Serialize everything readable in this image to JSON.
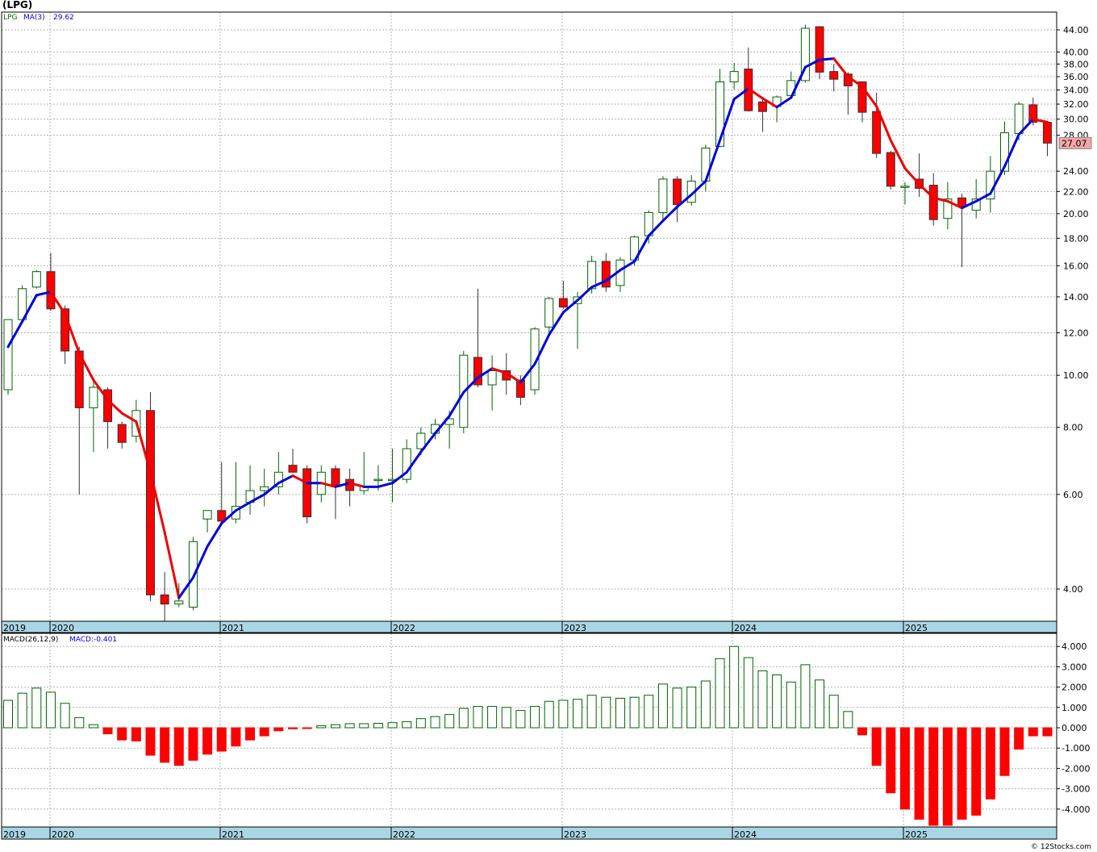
{
  "title": "(LPG)",
  "legend": {
    "symbol": "LPG",
    "ma_label": "MA(3)",
    "ma_value": "29.62"
  },
  "macd_legend": {
    "label": "MACD(26,12,9)",
    "value_label": "MACD:-0.401"
  },
  "last_price_label": "27.07",
  "copyright": "© 12Stocks.com",
  "colors": {
    "up": "#006400",
    "down": "#ff0000",
    "ma_up": "#0000dd",
    "ma_down": "#ee0000",
    "axis_band": "#a9d6e5",
    "grid": "#b0b0b0",
    "price_box": "#f4a6a6"
  },
  "chart_data": {
    "type": "candlestick",
    "scale": "log",
    "price_ticks": [
      "4.00",
      "6.00",
      "8.00",
      "10.00",
      "12.00",
      "14.00",
      "16.00",
      "18.00",
      "20.00",
      "22.00",
      "24.00",
      "28.00",
      "30.00",
      "32.00",
      "34.00",
      "36.00",
      "38.00",
      "40.00",
      "44.00"
    ],
    "year_labels": [
      "2019",
      "2020",
      "2021",
      "2022",
      "2023",
      "2024",
      "2025"
    ],
    "macd_ticks": [
      "4.000",
      "3.000",
      "2.000",
      "1.000",
      "0.000",
      "-1.000",
      "-2.000",
      "-3.000",
      "-4.000"
    ],
    "candles": [
      {
        "o": 9.4,
        "h": 12.7,
        "l": 9.2,
        "c": 12.7
      },
      {
        "o": 12.7,
        "h": 14.7,
        "l": 12.5,
        "c": 14.5
      },
      {
        "o": 14.6,
        "h": 15.7,
        "l": 14.5,
        "c": 15.6
      },
      {
        "o": 15.6,
        "h": 16.9,
        "l": 13.2,
        "c": 13.3
      },
      {
        "o": 13.3,
        "h": 13.5,
        "l": 10.5,
        "c": 11.1
      },
      {
        "o": 11.1,
        "h": 11.3,
        "l": 6.0,
        "c": 8.7
      },
      {
        "o": 8.7,
        "h": 9.9,
        "l": 7.2,
        "c": 9.5
      },
      {
        "o": 9.4,
        "h": 9.5,
        "l": 7.3,
        "c": 8.2
      },
      {
        "o": 8.1,
        "h": 8.2,
        "l": 7.3,
        "c": 7.5
      },
      {
        "o": 7.7,
        "h": 9.0,
        "l": 7.5,
        "c": 8.6
      },
      {
        "o": 8.6,
        "h": 9.3,
        "l": 3.8,
        "c": 3.9
      },
      {
        "o": 3.9,
        "h": 4.3,
        "l": 3.45,
        "c": 3.75
      },
      {
        "o": 3.75,
        "h": 4.1,
        "l": 3.7,
        "c": 3.8
      },
      {
        "o": 3.7,
        "h": 5.0,
        "l": 3.65,
        "c": 4.9
      },
      {
        "o": 5.4,
        "h": 5.6,
        "l": 5.1,
        "c": 5.6
      },
      {
        "o": 5.6,
        "h": 6.9,
        "l": 5.3,
        "c": 5.35
      },
      {
        "o": 5.4,
        "h": 6.9,
        "l": 5.3,
        "c": 5.7
      },
      {
        "o": 5.8,
        "h": 6.8,
        "l": 5.5,
        "c": 6.1
      },
      {
        "o": 6.1,
        "h": 6.7,
        "l": 5.7,
        "c": 6.2
      },
      {
        "o": 6.2,
        "h": 7.2,
        "l": 6.0,
        "c": 6.6
      },
      {
        "o": 6.8,
        "h": 7.3,
        "l": 6.6,
        "c": 6.6
      },
      {
        "o": 6.7,
        "h": 6.8,
        "l": 5.3,
        "c": 5.45
      },
      {
        "o": 6.0,
        "h": 6.8,
        "l": 5.8,
        "c": 6.6
      },
      {
        "o": 6.7,
        "h": 6.8,
        "l": 5.4,
        "c": 6.2
      },
      {
        "o": 6.4,
        "h": 6.7,
        "l": 5.7,
        "c": 6.1
      },
      {
        "o": 6.1,
        "h": 7.2,
        "l": 6.0,
        "c": 6.2
      },
      {
        "o": 6.4,
        "h": 6.8,
        "l": 6.1,
        "c": 6.4
      },
      {
        "o": 6.4,
        "h": 7.3,
        "l": 5.8,
        "c": 6.4
      },
      {
        "o": 6.4,
        "h": 7.6,
        "l": 6.3,
        "c": 7.3
      },
      {
        "o": 7.3,
        "h": 8.0,
        "l": 7.1,
        "c": 7.8
      },
      {
        "o": 7.8,
        "h": 8.3,
        "l": 7.6,
        "c": 8.1
      },
      {
        "o": 8.1,
        "h": 8.6,
        "l": 7.3,
        "c": 8.3
      },
      {
        "o": 8.0,
        "h": 11.1,
        "l": 7.8,
        "c": 10.9
      },
      {
        "o": 10.8,
        "h": 14.5,
        "l": 9.5,
        "c": 9.6
      },
      {
        "o": 9.6,
        "h": 10.9,
        "l": 8.6,
        "c": 10.2
      },
      {
        "o": 10.2,
        "h": 11.0,
        "l": 9.2,
        "c": 9.8
      },
      {
        "o": 9.8,
        "h": 10.0,
        "l": 8.8,
        "c": 9.1
      },
      {
        "o": 9.4,
        "h": 12.3,
        "l": 9.2,
        "c": 12.2
      },
      {
        "o": 12.3,
        "h": 14.0,
        "l": 12.0,
        "c": 13.9
      },
      {
        "o": 13.9,
        "h": 15.0,
        "l": 13.3,
        "c": 13.4
      },
      {
        "o": 13.6,
        "h": 14.3,
        "l": 11.2,
        "c": 14.0
      },
      {
        "o": 14.5,
        "h": 16.7,
        "l": 14.2,
        "c": 16.3
      },
      {
        "o": 16.3,
        "h": 16.9,
        "l": 14.3,
        "c": 14.6
      },
      {
        "o": 14.7,
        "h": 16.6,
        "l": 14.3,
        "c": 16.4
      },
      {
        "o": 16.4,
        "h": 18.2,
        "l": 16.0,
        "c": 18.1
      },
      {
        "o": 18.2,
        "h": 20.3,
        "l": 17.6,
        "c": 20.1
      },
      {
        "o": 20.1,
        "h": 23.5,
        "l": 19.4,
        "c": 23.2
      },
      {
        "o": 23.2,
        "h": 23.5,
        "l": 19.3,
        "c": 20.8
      },
      {
        "o": 21.0,
        "h": 23.6,
        "l": 20.7,
        "c": 23.0
      },
      {
        "o": 23.0,
        "h": 26.9,
        "l": 22.0,
        "c": 26.5
      },
      {
        "o": 26.7,
        "h": 37.2,
        "l": 26.6,
        "c": 35.2
      },
      {
        "o": 35.2,
        "h": 38.2,
        "l": 34.1,
        "c": 36.8
      },
      {
        "o": 37.2,
        "h": 40.8,
        "l": 31.0,
        "c": 31.1
      },
      {
        "o": 32.3,
        "h": 32.7,
        "l": 28.4,
        "c": 31.0
      },
      {
        "o": 31.7,
        "h": 33.2,
        "l": 29.6,
        "c": 33.0
      },
      {
        "o": 33.2,
        "h": 36.8,
        "l": 32.8,
        "c": 35.4
      },
      {
        "o": 35.4,
        "h": 45.0,
        "l": 35.1,
        "c": 44.3
      },
      {
        "o": 44.6,
        "h": 44.7,
        "l": 35.6,
        "c": 36.7
      },
      {
        "o": 36.8,
        "h": 38.0,
        "l": 33.8,
        "c": 35.6
      },
      {
        "o": 36.4,
        "h": 36.7,
        "l": 30.6,
        "c": 34.6
      },
      {
        "o": 35.2,
        "h": 35.3,
        "l": 29.6,
        "c": 30.9
      },
      {
        "o": 31.0,
        "h": 33.6,
        "l": 25.4,
        "c": 25.9
      },
      {
        "o": 26.0,
        "h": 26.2,
        "l": 22.2,
        "c": 22.5
      },
      {
        "o": 22.4,
        "h": 22.9,
        "l": 20.8,
        "c": 22.5
      },
      {
        "o": 23.2,
        "h": 25.9,
        "l": 21.5,
        "c": 22.3
      },
      {
        "o": 22.6,
        "h": 23.8,
        "l": 19.0,
        "c": 19.5
      },
      {
        "o": 19.6,
        "h": 22.9,
        "l": 18.7,
        "c": 21.3
      },
      {
        "o": 21.4,
        "h": 21.8,
        "l": 15.9,
        "c": 20.6
      },
      {
        "o": 20.3,
        "h": 23.2,
        "l": 19.6,
        "c": 21.3
      },
      {
        "o": 21.3,
        "h": 25.6,
        "l": 20.1,
        "c": 24.0
      },
      {
        "o": 24.0,
        "h": 29.7,
        "l": 23.6,
        "c": 28.3
      },
      {
        "o": 28.2,
        "h": 32.3,
        "l": 27.4,
        "c": 32.0
      },
      {
        "o": 31.9,
        "h": 32.9,
        "l": 29.2,
        "c": 29.6
      },
      {
        "o": 29.6,
        "h": 29.7,
        "l": 25.6,
        "c": 27.07
      }
    ],
    "ma": [
      11.3,
      12.6,
      14.1,
      14.3,
      13.0,
      11.0,
      9.8,
      9.0,
      8.5,
      8.2,
      6.6,
      5.1,
      3.85,
      4.2,
      4.8,
      5.3,
      5.6,
      5.8,
      6.0,
      6.3,
      6.5,
      6.3,
      6.3,
      6.2,
      6.3,
      6.2,
      6.2,
      6.3,
      6.6,
      7.2,
      7.8,
      8.4,
      9.3,
      9.9,
      10.3,
      10.1,
      9.7,
      10.5,
      11.9,
      13.1,
      13.8,
      14.6,
      15.0,
      15.7,
      16.3,
      18.2,
      19.4,
      20.6,
      21.7,
      23.0,
      27.4,
      32.7,
      34.2,
      32.8,
      31.6,
      32.9,
      37.5,
      38.7,
      38.9,
      36.0,
      34.5,
      31.7,
      27.4,
      24.3,
      22.7,
      21.4,
      21.1,
      20.5,
      21.1,
      21.8,
      24.5,
      28.1,
      30.0,
      29.62
    ],
    "macd": [
      1.35,
      1.7,
      1.95,
      1.75,
      1.2,
      0.5,
      0.15,
      -0.3,
      -0.6,
      -0.65,
      -1.35,
      -1.7,
      -1.85,
      -1.6,
      -1.3,
      -1.15,
      -0.9,
      -0.6,
      -0.4,
      -0.15,
      -0.05,
      -0.02,
      0.1,
      0.15,
      0.2,
      0.2,
      0.22,
      0.25,
      0.3,
      0.45,
      0.55,
      0.65,
      0.95,
      1.05,
      1.05,
      1.0,
      0.85,
      1.05,
      1.3,
      1.35,
      1.4,
      1.6,
      1.5,
      1.45,
      1.5,
      1.6,
      2.15,
      1.95,
      2.0,
      2.3,
      3.4,
      4.0,
      3.45,
      2.8,
      2.6,
      2.25,
      3.1,
      2.35,
      1.6,
      0.8,
      -0.35,
      -1.85,
      -3.2,
      -4.0,
      -4.5,
      -4.8,
      -4.8,
      -4.5,
      -4.3,
      -3.5,
      -2.35,
      -1.05,
      -0.4,
      -0.401
    ]
  }
}
